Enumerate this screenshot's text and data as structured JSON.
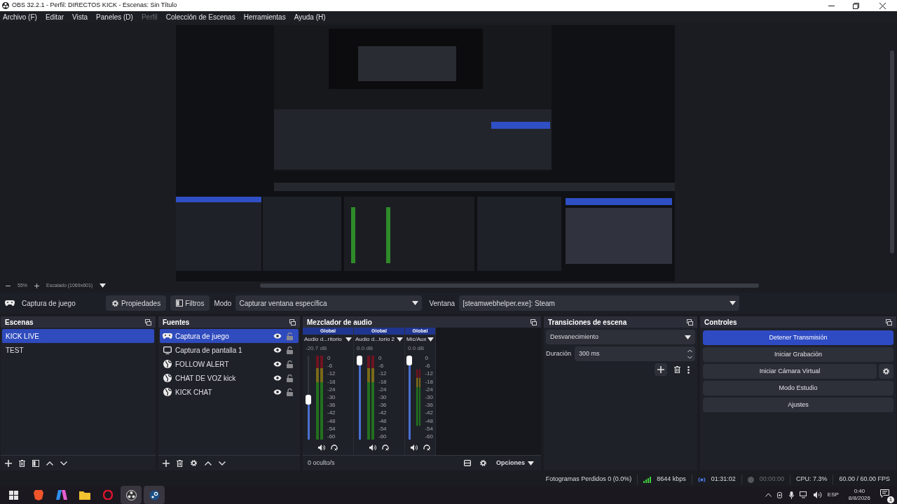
{
  "window": {
    "title": "OBS 32.2.1 - Perfil: DIRECTOS KICK - Escenas: Sin Título"
  },
  "menu": [
    {
      "label": "Archivo (F)",
      "disabled": false
    },
    {
      "label": "Editar",
      "disabled": false
    },
    {
      "label": "Vista",
      "disabled": false
    },
    {
      "label": "Paneles (D)",
      "disabled": false
    },
    {
      "label": "Perfil",
      "disabled": true
    },
    {
      "label": "Colección de Escenas",
      "disabled": false
    },
    {
      "label": "Herramientas",
      "disabled": false
    },
    {
      "label": "Ayuda (H)",
      "disabled": false
    }
  ],
  "zoom_bar": {
    "zoom": "55%",
    "scale": "Escalado (1069x601)"
  },
  "source_toolbar": {
    "source": "Captura de juego",
    "properties": "Propiedades",
    "filters": "Filtros",
    "mode_label": "Modo",
    "mode_value": "Capturar ventana específica",
    "window_label": "Ventana",
    "window_value": "[steamwebhelper.exe]: Steam"
  },
  "scenes": {
    "title": "Escenas",
    "items": [
      {
        "label": "KICK LIVE",
        "selected": true
      },
      {
        "label": "TEST",
        "selected": false
      }
    ]
  },
  "sources": {
    "title": "Fuentes",
    "items": [
      {
        "label": "Captura de juego",
        "kind": "game",
        "selected": true,
        "visible": true,
        "locked": false
      },
      {
        "label": "Captura de pantalla 1",
        "kind": "display",
        "selected": false,
        "visible": true,
        "locked": false
      },
      {
        "label": "FOLLOW ALERT",
        "kind": "browser",
        "selected": false,
        "visible": true,
        "locked": false
      },
      {
        "label": "CHAT DE VOZ kick",
        "kind": "browser",
        "selected": false,
        "visible": true,
        "locked": false
      },
      {
        "label": "KICK CHAT",
        "kind": "browser",
        "selected": false,
        "visible": true,
        "locked": false
      }
    ]
  },
  "mixer": {
    "title": "Mezclador de audio",
    "channels": [
      {
        "tag": "Global",
        "name": "Audio d...ritorio",
        "reading": "-20.7 dB",
        "level": 0.47,
        "scale": [
          "0",
          "-6",
          "-12",
          "-18",
          "-24",
          "-30",
          "-36",
          "-42",
          "-48",
          "-54",
          "-60"
        ]
      },
      {
        "tag": "Global",
        "name": "Audio d...torio 2",
        "reading": "0.0 dB",
        "level": 1,
        "scale": [
          "0",
          "-6",
          "-12",
          "-18",
          "-24",
          "-30",
          "-36",
          "-42",
          "-48",
          "-54",
          "-60"
        ]
      },
      {
        "tag": "Global",
        "name": "Mic/Aux",
        "reading": "0.0 dB",
        "level": 1,
        "scale": [
          "0",
          "-6",
          "-12",
          "-18",
          "-24",
          "-30",
          "-36",
          "-42",
          "-48",
          "-54",
          "-60"
        ]
      }
    ],
    "hidden": "0 oculto/s",
    "options": "Opciones"
  },
  "transitions": {
    "title": "Transiciones de escena",
    "transition": "Desvanecimiento",
    "duration_label": "Duración",
    "duration": "300 ms"
  },
  "controls": {
    "title": "Controles",
    "buttons": [
      {
        "label": "Detener Transmisión",
        "active": true,
        "settings": false
      },
      {
        "label": "Iniciar Grabación",
        "active": false,
        "settings": false
      },
      {
        "label": "Iniciar Cámara Virtual",
        "active": false,
        "settings": true
      },
      {
        "label": "Modo Estudio",
        "active": false,
        "settings": false
      },
      {
        "label": "Ajustes",
        "active": false,
        "settings": false
      }
    ]
  },
  "status_bar": {
    "dropped": "Fotogramas Perdidos 0 (0.0%)",
    "bitrate": "8644 kbps",
    "stream_time": "01:31:02",
    "record_time": "00:00:00",
    "cpu": "CPU: 7.3%",
    "fps": "60.00 / 60.00 FPS"
  },
  "taskbar": {
    "language": "ESP",
    "time": "0:40",
    "date": "8/8/2026",
    "notifications": "1"
  }
}
